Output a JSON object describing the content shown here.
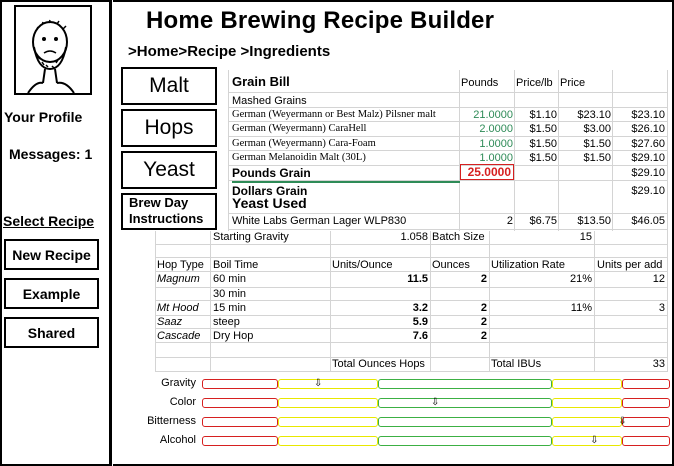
{
  "sidebar": {
    "profile_label": "Your Profile",
    "messages_label": "Messages: 1",
    "select_recipe_label": "Select Recipe",
    "buttons": [
      "New Recipe",
      "Example",
      "Shared"
    ]
  },
  "header": {
    "title": "Home Brewing Recipe Builder",
    "breadcrumb": ">Home>Recipe >Ingredients"
  },
  "nav_tabs": [
    "Malt",
    "Hops",
    "Yeast",
    "Brew Day",
    "Instructions"
  ],
  "grain": {
    "title": "Grain Bill",
    "subtitle": "Mashed Grains",
    "headers": {
      "pounds": "Pounds",
      "price_lb": "Price/lb",
      "price": "Price"
    },
    "rows": [
      {
        "name": "German (Weyermann or Best Malz) Pilsner malt",
        "pounds": "21.0000",
        "price_lb": "$1.10",
        "price": "$23.10",
        "total": "$23.10"
      },
      {
        "name": "German (Weyermann) CaraHell",
        "pounds": "2.0000",
        "price_lb": "$1.50",
        "price": "$3.00",
        "total": "$26.10"
      },
      {
        "name": "German (Weyermann) Cara-Foam",
        "pounds": "1.0000",
        "price_lb": "$1.50",
        "price": "$1.50",
        "total": "$27.60"
      },
      {
        "name": "German Melanoidin Malt (30L)",
        "pounds": "1.0000",
        "price_lb": "$1.50",
        "price": "$1.50",
        "total": "$29.10"
      }
    ],
    "pounds_grain_label": "Pounds Grain",
    "pounds_grain_value": "25.0000",
    "pounds_grain_total": "$29.10",
    "dollars_grain_label": "Dollars Grain",
    "dollars_grain_total": "$29.10",
    "yeast_used_label": "Yeast Used"
  },
  "yeast": {
    "name": "White Labs German Lager WLP830",
    "qty": "2",
    "price_each": "$6.75",
    "price": "$13.50",
    "total": "$46.05"
  },
  "gravity": {
    "starting_label": "Starting Gravity",
    "starting_value": "1.058",
    "batch_label": "Batch Size",
    "batch_value": "15"
  },
  "hops": {
    "headers": [
      "Hop Type",
      "Boil Time",
      "Units/Ounce",
      "Ounces",
      "Utilization Rate",
      "Units per add"
    ],
    "rows": [
      {
        "type": "Magnum",
        "time": "60 min",
        "units": "11.5",
        "ounces": "2",
        "util": "21%",
        "per_add": "12"
      },
      {
        "type": "",
        "time": "30 min",
        "units": "",
        "ounces": "",
        "util": "",
        "per_add": ""
      },
      {
        "type": "Mt Hood",
        "time": "15 min",
        "units": "3.2",
        "ounces": "2",
        "util": "11%",
        "per_add": "3"
      },
      {
        "type": "Saaz",
        "time": "steep",
        "units": "5.9",
        "ounces": "2",
        "util": "",
        "per_add": ""
      },
      {
        "type": "Cascade",
        "time": "Dry Hop",
        "units": "7.6",
        "ounces": "2",
        "util": "",
        "per_add": ""
      }
    ],
    "total_ounces_label": "Total Ounces Hops",
    "total_ibu_label": "Total IBUs",
    "total_ibu_value": "33"
  },
  "meters": [
    {
      "label": "Gravity",
      "level": 0.25
    },
    {
      "label": "Color",
      "level": 0.5
    },
    {
      "label": "Bitterness",
      "level": 0.9
    },
    {
      "label": "Alcohol",
      "level": 0.84
    }
  ],
  "meter_pointer_glyph": "⇩",
  "colors": {
    "green": "#2e8b57",
    "red": "#d62020",
    "yellow": "#e8e800",
    "meter_green": "#3cb043"
  }
}
